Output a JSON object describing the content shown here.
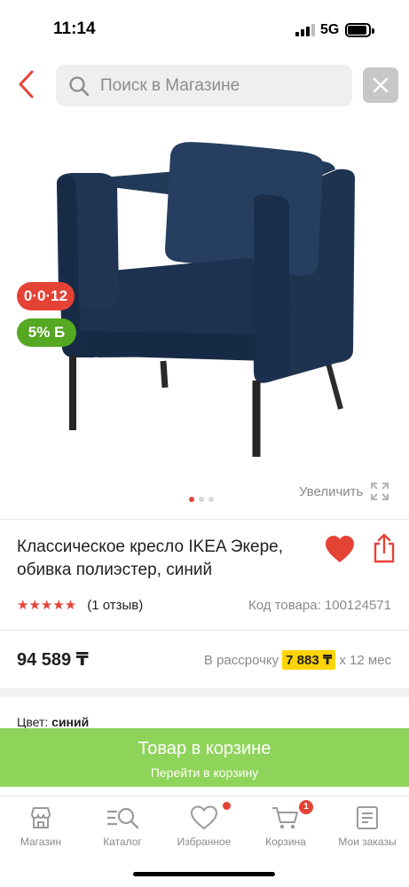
{
  "status_bar": {
    "time": "11:14",
    "network": "5G"
  },
  "search": {
    "placeholder": "Поиск в Магазине"
  },
  "product": {
    "badge_installment": "0·0·12",
    "badge_bonus": "5% Б",
    "zoom_label": "Увеличить",
    "title": "Классическое кресло IKEA Экере, обивка полиэстер, синий",
    "rating_stars": "★★★★★",
    "reviews": "(1 отзыв)",
    "sku": "Код товара: 100124571",
    "price": "94 589 ₸",
    "installment_prefix": "В рассрочку",
    "installment_amount": "7 883 ₸",
    "installment_suffix": "х 12 мес",
    "color_label": "Цвет:",
    "color_value": "синий",
    "rating": 5,
    "image_page": 1,
    "image_pages": 3
  },
  "cart_banner": {
    "title": "Товар в корзине",
    "subtitle": "Перейти в корзину"
  },
  "tab_bar": {
    "shop": "Магазин",
    "catalog": "Каталог",
    "favorites": "Избранное",
    "cart": "Корзина",
    "cart_count": "1",
    "orders": "Мои заказы"
  },
  "colors": {
    "accent_red": "#e54236",
    "bonus_green": "#55a822",
    "banner_green": "#8fd45a",
    "installment_yellow": "#ffd400",
    "chair_blue": "#1e3350"
  },
  "icons": [
    "back-arrow-icon",
    "search-icon",
    "close-icon",
    "expand-icon",
    "heart-icon",
    "share-icon",
    "shop-icon",
    "catalog-icon",
    "favorites-icon",
    "cart-icon",
    "orders-icon"
  ]
}
